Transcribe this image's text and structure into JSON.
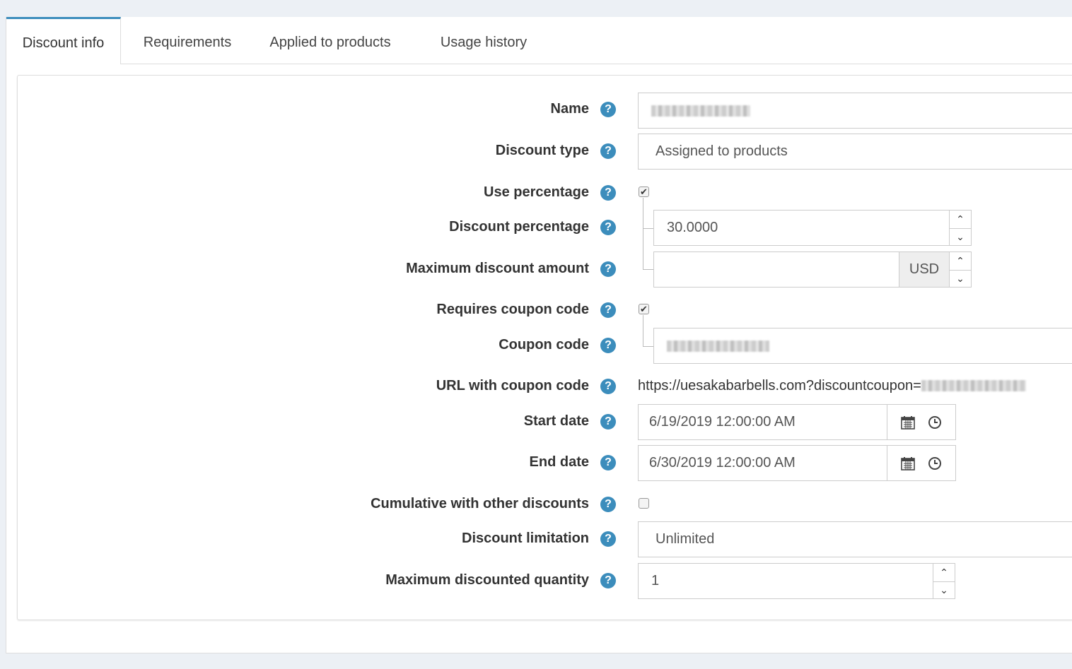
{
  "tabs": [
    "Discount info",
    "Requirements",
    "Applied to products",
    "Usage history"
  ],
  "labels": {
    "name": "Name",
    "discount_type": "Discount type",
    "use_percentage": "Use percentage",
    "discount_percentage": "Discount percentage",
    "max_discount_amount": "Maximum discount amount",
    "requires_coupon": "Requires coupon code",
    "coupon_code": "Coupon code",
    "url_with_coupon": "URL with coupon code",
    "start_date": "Start date",
    "end_date": "End date",
    "cumulative": "Cumulative with other discounts",
    "discount_limitation": "Discount limitation",
    "max_discounted_qty": "Maximum discounted quantity"
  },
  "help_glyph": "?",
  "values": {
    "discount_type": "Assigned to products",
    "use_percentage": true,
    "discount_percentage": "30.0000",
    "max_discount_amount": "",
    "currency": "USD",
    "requires_coupon": true,
    "url_prefix": "https://uesakabarbells.com?discountcoupon=",
    "start_date": "6/19/2019 12:00:00 AM",
    "end_date": "6/30/2019 12:00:00 AM",
    "cumulative": false,
    "discount_limitation": "Unlimited",
    "max_discounted_qty": "1"
  },
  "icons": {
    "help": "question-circle-icon",
    "calendar": "calendar-icon",
    "clock": "clock-icon",
    "spin_up": "chevron-up-icon",
    "spin_down": "chevron-down-icon",
    "check": "checkmark-icon"
  },
  "colors": {
    "accent": "#3c8dbc",
    "background": "#ecf0f5",
    "border": "#cccccc"
  },
  "glyphs": {
    "up": "⌃",
    "down": "⌄",
    "check": "✔"
  }
}
